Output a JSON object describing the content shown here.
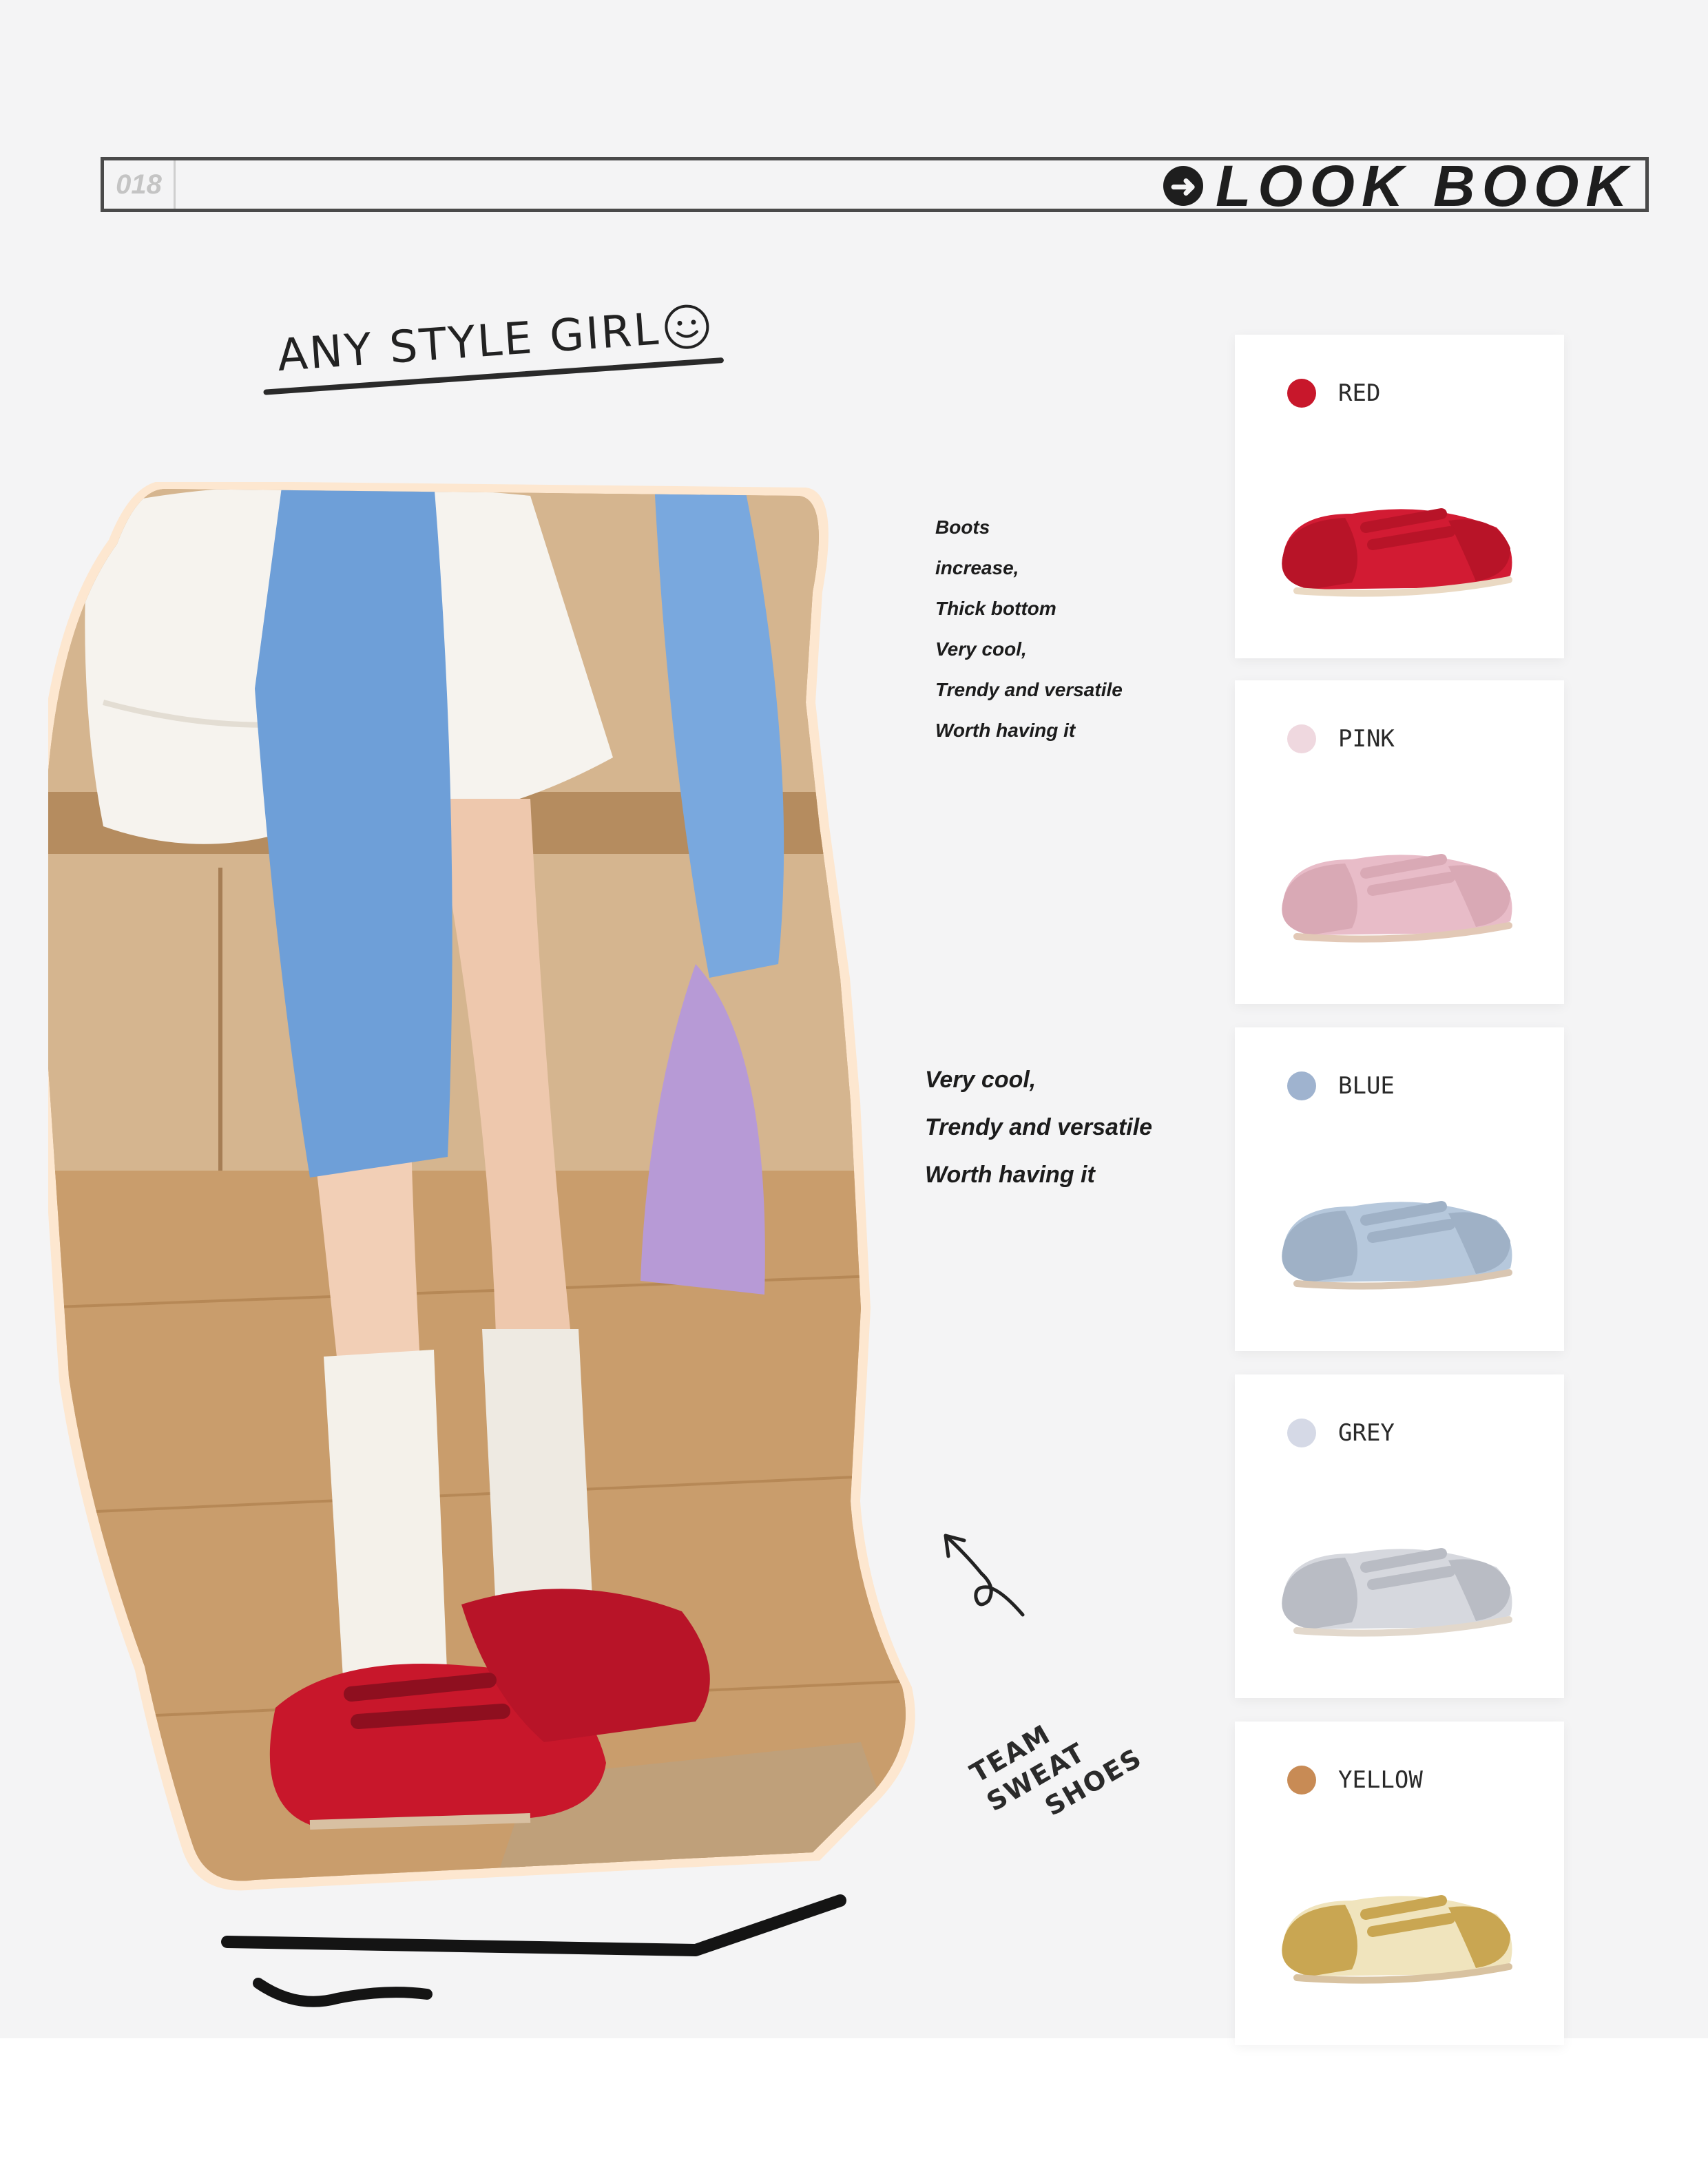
{
  "header": {
    "page_number": "018",
    "title": "LOOK BOOK"
  },
  "heading": {
    "text": "ANY STYLE GIRL"
  },
  "description_1": {
    "lines": [
      "Boots",
      "increase,",
      "Thick bottom",
      "Very cool,",
      "Trendy and versatile",
      "Worth having it"
    ]
  },
  "description_2": {
    "lines": [
      "Very cool,",
      "Trendy and versatile",
      "Worth having it"
    ]
  },
  "stamp": {
    "lines": [
      "TEAM",
      "SWEAT",
      "SHOES"
    ]
  },
  "colors": [
    {
      "name": "RED",
      "dot": "#c8172b",
      "upper": "#d21b33",
      "suede": "#b81428",
      "sole": "#ead9c3"
    },
    {
      "name": "PINK",
      "dot": "#efd8df",
      "upper": "#e8bcc8",
      "suede": "#d9a9b5",
      "sole": "#e2c8b6"
    },
    {
      "name": "BLUE",
      "dot": "#9fb3cf",
      "upper": "#b6c8dc",
      "suede": "#9fb1c6",
      "sole": "#d9c6b2"
    },
    {
      "name": "GREY",
      "dot": "#d5d9e6",
      "upper": "#d6d8de",
      "suede": "#b9bcc4",
      "sole": "#e2d8cc"
    },
    {
      "name": "YELLOW",
      "dot": "#c88b55",
      "upper": "#f0e4bd",
      "suede": "#c9a652",
      "sole": "#d8c2a0"
    }
  ]
}
